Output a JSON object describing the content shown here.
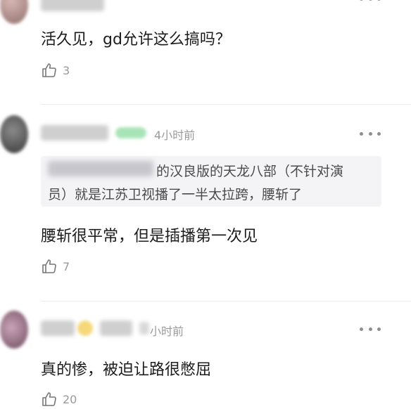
{
  "comments": [
    {
      "time": "",
      "text": "活久见，gd允许这么搞吗？",
      "likes": "3",
      "quote": {
        "line1": "",
        "line2": ""
      }
    },
    {
      "time": "4小时前",
      "text": "腰斩很平常，但是插播第一次见",
      "likes": "7",
      "quote": {
        "line1": "的汉良版的天龙八部（不针对演",
        "line2": "员）就是江苏卫视播了一半太拉跨，腰斩了"
      }
    },
    {
      "time": "小时前",
      "text": "真的惨，被迫让路很憋屈",
      "likes": "20",
      "quote": {
        "line1": "",
        "line2": ""
      }
    }
  ],
  "icons": {
    "like": "thumbs-up-icon",
    "more": "more-dots-icon"
  },
  "colors": {
    "text": "#1c1c1c",
    "muted": "#9a9a9a",
    "quote_bg": "#f4f4f6",
    "badge": "#a9e4b8"
  }
}
